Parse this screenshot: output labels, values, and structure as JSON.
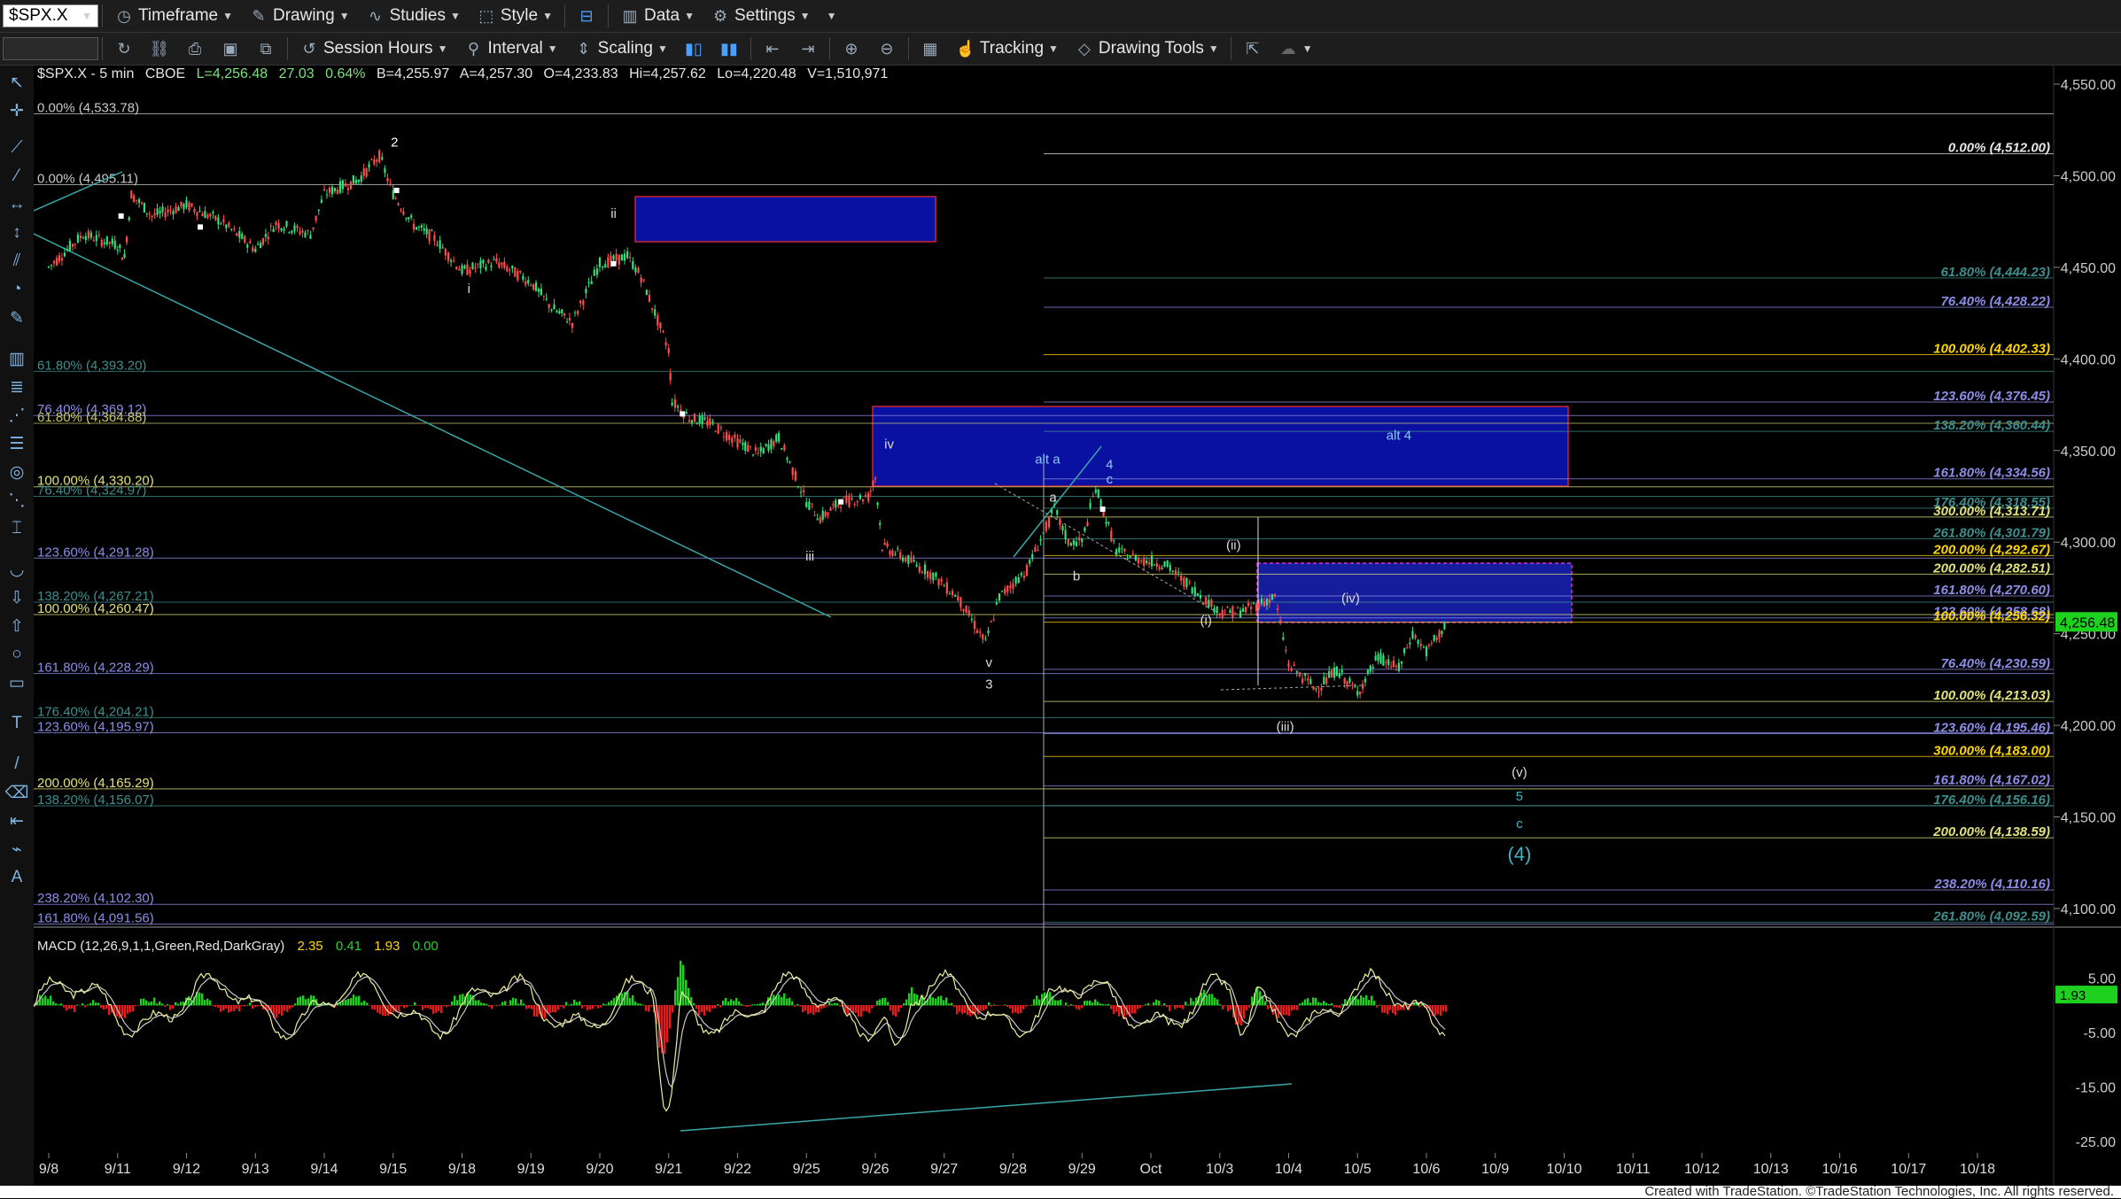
{
  "toolbar": {
    "symbol": "$SPX.X",
    "timeframe": "Timeframe",
    "drawing": "Drawing",
    "studies": "Studies",
    "style": "Style",
    "data": "Data",
    "settings": "Settings",
    "session_hours": "Session Hours",
    "interval": "Interval",
    "scaling": "Scaling",
    "tracking": "Tracking",
    "drawing_tools": "Drawing Tools"
  },
  "header": {
    "symbol": "$SPX.X - 5 min",
    "exchange": "CBOE",
    "last": "L=4,256.48",
    "change": "27.03",
    "change_pct": "0.64%",
    "bid": "B=4,255.97",
    "ask": "A=4,257.30",
    "open": "O=4,233.83",
    "high": "Hi=4,257.62",
    "low": "Lo=4,220.48",
    "volume": "V=1,510,971"
  },
  "macd": {
    "title": "MACD (12,26,9,1,1,Green,Red,DarkGray)",
    "macd": "2.35",
    "signal": "0.41",
    "diff": "1.93",
    "zero": "0.00",
    "ticks": [
      5,
      -5,
      -15,
      -25
    ],
    "last_tag": "1.93",
    "colors": {
      "pos": "#1fd11f",
      "neg": "#e61c1c",
      "macd_line": "#f0f0a0",
      "signal_line": "#c8c8c8"
    }
  },
  "footer": "Created with TradeStation. ©TradeStation Technologies, Inc. All rights reserved.",
  "chart_data": {
    "type": "line",
    "ylim": [
      4085,
      4555
    ],
    "price_ticks": [
      4550,
      4500,
      4450,
      4400,
      4350,
      4300,
      4250,
      4200,
      4150,
      4100
    ],
    "last_price_tag": "4,256.48",
    "x_labels": [
      "9/8",
      "9/11",
      "9/12",
      "9/13",
      "9/14",
      "9/15",
      "9/18",
      "9/19",
      "9/20",
      "9/21",
      "9/22",
      "9/25",
      "9/26",
      "9/27",
      "9/28",
      "9/29",
      "Oct",
      "10/3",
      "10/4",
      "10/5",
      "10/6",
      "10/9",
      "10/10",
      "10/11",
      "10/12",
      "10/13",
      "10/16",
      "10/17",
      "10/18"
    ],
    "series": [
      {
        "points": [
          [
            0,
            4450
          ],
          [
            0.5,
            4468
          ],
          [
            1,
            4462
          ],
          [
            1.1,
            4455
          ],
          [
            1.2,
            4490
          ],
          [
            1.5,
            4478
          ],
          [
            2,
            4484
          ],
          [
            2.5,
            4475
          ],
          [
            3,
            4460
          ],
          [
            3.3,
            4474
          ],
          [
            3.8,
            4468
          ],
          [
            4,
            4490
          ],
          [
            4.5,
            4498
          ],
          [
            4.8,
            4511
          ],
          [
            5,
            4490
          ],
          [
            5.3,
            4473
          ],
          [
            5.6,
            4466
          ],
          [
            6,
            4448
          ],
          [
            6.5,
            4453
          ],
          [
            7,
            4442
          ],
          [
            7.3,
            4428
          ],
          [
            7.6,
            4420
          ],
          [
            8,
            4452
          ],
          [
            8.4,
            4456
          ],
          [
            8.6,
            4445
          ],
          [
            9,
            4405
          ],
          [
            9.05,
            4377
          ],
          [
            9.3,
            4368
          ],
          [
            9.6,
            4365
          ],
          [
            10,
            4355
          ],
          [
            10.3,
            4348
          ],
          [
            10.6,
            4357
          ],
          [
            11,
            4322
          ],
          [
            11.2,
            4313
          ],
          [
            11.5,
            4322
          ],
          [
            11.9,
            4325
          ],
          [
            12,
            4335
          ],
          [
            12.1,
            4298
          ],
          [
            12.4,
            4292
          ],
          [
            12.8,
            4283
          ],
          [
            13.2,
            4270
          ],
          [
            13.6,
            4245
          ],
          [
            13.8,
            4270
          ],
          [
            14.2,
            4285
          ],
          [
            14.6,
            4318
          ],
          [
            14.8,
            4300
          ],
          [
            15,
            4300
          ],
          [
            15.2,
            4330
          ],
          [
            15.5,
            4295
          ],
          [
            15.9,
            4290
          ],
          [
            16.2,
            4288
          ],
          [
            16.6,
            4275
          ],
          [
            17,
            4262
          ],
          [
            17.3,
            4262
          ],
          [
            17.8,
            4270
          ],
          [
            18,
            4233
          ],
          [
            18.4,
            4220
          ],
          [
            18.7,
            4230
          ],
          [
            19,
            4218
          ],
          [
            19.3,
            4237
          ],
          [
            19.6,
            4231
          ],
          [
            19.8,
            4250
          ],
          [
            20,
            4240
          ],
          [
            20.3,
            4256
          ]
        ]
      }
    ],
    "annotations": [
      "2",
      "i",
      "ii",
      "iii",
      "iv",
      "v",
      "3",
      "a",
      "b",
      "c",
      "4",
      "alt a",
      "alt 4",
      "(i)",
      "(ii)",
      "(iii)",
      "(iv)",
      "(v)",
      "5",
      "c",
      "(4)"
    ],
    "fib_left": [
      {
        "label": "0.00% (4,533.78)",
        "y": 4533.78,
        "color": "#c8c8c8"
      },
      {
        "label": "0.00% (4,495.11)",
        "y": 4495.11,
        "color": "#c8c8c8"
      },
      {
        "label": "61.80% (4,393.20)",
        "y": 4393.2,
        "color": "#3e8e8e"
      },
      {
        "label": "76.40% (4,369.12)",
        "y": 4369.12,
        "color": "#8d8de8"
      },
      {
        "label": "61.80% (4,364.88)",
        "y": 4364.88,
        "color": "#c7c76a"
      },
      {
        "label": "100.00% (4,330.20)",
        "y": 4330.2,
        "color": "#e2e27a"
      },
      {
        "label": "76.40% (4,324.97)",
        "y": 4324.97,
        "color": "#3e8e8e"
      },
      {
        "label": "123.60% (4,291.28)",
        "y": 4291.28,
        "color": "#8d8de8"
      },
      {
        "label": "138.20% (4,267.21)",
        "y": 4267.21,
        "color": "#3e8e8e"
      },
      {
        "label": "100.00% (4,260.47)",
        "y": 4260.47,
        "color": "#e2e27a"
      },
      {
        "label": "161.80% (4,228.29)",
        "y": 4228.29,
        "color": "#8d8de8"
      },
      {
        "label": "176.40% (4,204.21)",
        "y": 4204.21,
        "color": "#3e8e8e"
      },
      {
        "label": "123.60% (4,195.97)",
        "y": 4195.97,
        "color": "#8d8de8"
      },
      {
        "label": "200.00% (4,165.29)",
        "y": 4165.29,
        "color": "#e2e27a"
      },
      {
        "label": "138.20% (4,156.07)",
        "y": 4156.07,
        "color": "#3e8e8e"
      },
      {
        "label": "238.20% (4,102.30)",
        "y": 4102.3,
        "color": "#8d8de8"
      },
      {
        "label": "161.80% (4,091.56)",
        "y": 4091.56,
        "color": "#8d8de8"
      }
    ],
    "fib_right": [
      {
        "label": "0.00% (4,512.00)",
        "y": 4512.0,
        "color": "#e8e8e8"
      },
      {
        "label": "61.80% (4,444.23)",
        "y": 4444.23,
        "color": "#3e8e8e"
      },
      {
        "label": "76.40% (4,428.22)",
        "y": 4428.22,
        "color": "#8d8de8"
      },
      {
        "label": "100.00% (4,402.33)",
        "y": 4402.33,
        "color": "#ffd700"
      },
      {
        "label": "123.60% (4,376.45)",
        "y": 4376.45,
        "color": "#8d8de8"
      },
      {
        "label": "138.20% (4,360.44)",
        "y": 4360.44,
        "color": "#3e8e8e"
      },
      {
        "label": "161.80% (4,334.56)",
        "y": 4334.56,
        "color": "#8d8de8"
      },
      {
        "label": "176.40% (4,318.55)",
        "y": 4318.55,
        "color": "#3e8e8e"
      },
      {
        "label": "300.00% (4,313.71)",
        "y": 4313.71,
        "color": "#e2e27a"
      },
      {
        "label": "261.80% (4,301.79)",
        "y": 4301.79,
        "color": "#3e8e8e"
      },
      {
        "label": "200.00% (4,292.67)",
        "y": 4292.67,
        "color": "#ffd700"
      },
      {
        "label": "200.00% (4,282.51)",
        "y": 4282.51,
        "color": "#e2e27a"
      },
      {
        "label": "161.80% (4,270.60)",
        "y": 4270.6,
        "color": "#8d8de8"
      },
      {
        "label": "123.60% (4,258.68)",
        "y": 4258.68,
        "color": "#8d8de8"
      },
      {
        "label": "100.00% (4,256.32)",
        "y": 4256.32,
        "color": "#ffd700"
      },
      {
        "label": "76.40% (4,230.59)",
        "y": 4230.59,
        "color": "#8d8de8"
      },
      {
        "label": "100.00% (4,213.03)",
        "y": 4213.03,
        "color": "#e2e27a"
      },
      {
        "label": "123.60% (4,195.46)",
        "y": 4195.46,
        "color": "#8d8de8"
      },
      {
        "label": "300.00% (4,183.00)",
        "y": 4183.0,
        "color": "#ffd700"
      },
      {
        "label": "161.80% (4,167.02)",
        "y": 4167.02,
        "color": "#8d8de8"
      },
      {
        "label": "176.40% (4,156.16)",
        "y": 4156.16,
        "color": "#3e8e8e"
      },
      {
        "label": "200.00% (4,138.59)",
        "y": 4138.59,
        "color": "#e2e27a"
      },
      {
        "label": "238.20% (4,110.16)",
        "y": 4110.16,
        "color": "#8d8de8"
      },
      {
        "label": "261.80% (4,092.59)",
        "y": 4092.59,
        "color": "#3e8e8e"
      }
    ],
    "colors": {
      "up": "#33e07a",
      "down": "#ff4d4d",
      "box": "#0a10a0",
      "box_border": "#cc2233"
    }
  }
}
